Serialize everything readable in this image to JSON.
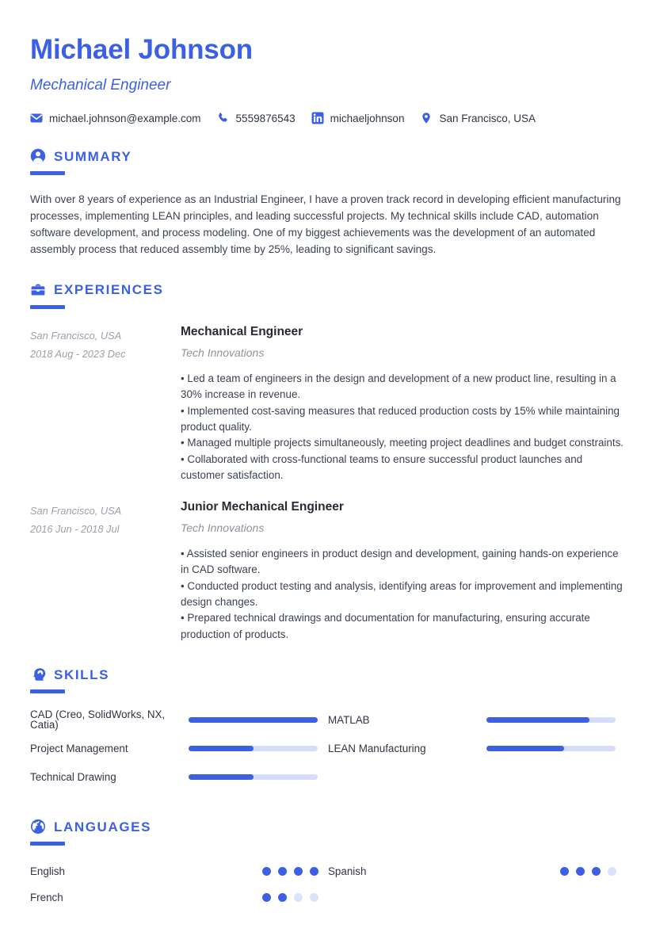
{
  "theme": {
    "accent": "#3b60e4",
    "accent_light": "#d6ddfb",
    "text": "#2f3542",
    "muted": "#9aa0a9"
  },
  "header": {
    "name": "Michael Johnson",
    "job_title": "Mechanical Engineer",
    "contacts": [
      {
        "icon": "envelope-icon",
        "text": "michael.johnson@example.com"
      },
      {
        "icon": "phone-icon",
        "text": "5559876543"
      },
      {
        "icon": "linkedin-icon",
        "text": "michaeljohnson"
      },
      {
        "icon": "location-pin-icon",
        "text": "San Francisco, USA"
      }
    ]
  },
  "summary": {
    "icon": "person-circle-icon",
    "title": "SUMMARY",
    "text": "With over 8 years of experience as an Industrial Engineer, I have a proven track record in developing efficient manufacturing processes, implementing LEAN principles, and leading successful projects. My technical skills include CAD, automation software development, and process modeling. One of my biggest achievements was the development of an automated assembly process that reduced assembly time by 25%, leading to significant savings."
  },
  "experiences": {
    "icon": "briefcase-icon",
    "title": "EXPERIENCES",
    "entries": [
      {
        "location": "San Francisco, USA",
        "dates": "2018 Aug - 2023 Dec",
        "role": "Mechanical Engineer",
        "company": "Tech Innovations",
        "bullets": [
          "• Led a team of engineers in the design and development of a new product line, resulting in a 30% increase in revenue.",
          "• Implemented cost-saving measures that reduced production costs by 15% while maintaining product quality.",
          "• Managed multiple projects simultaneously, meeting project deadlines and budget constraints.",
          "• Collaborated with cross-functional teams to ensure successful product launches and customer satisfaction."
        ]
      },
      {
        "location": "San Francisco, USA",
        "dates": "2016 Jun - 2018 Jul",
        "role": "Junior Mechanical Engineer",
        "company": "Tech Innovations",
        "bullets": [
          "• Assisted senior engineers in product design and development, gaining hands-on experience in CAD software.",
          "• Conducted product testing and analysis, identifying areas for improvement and implementing design changes.",
          "• Prepared technical drawings and documentation for manufacturing, ensuring accurate production of products."
        ]
      }
    ]
  },
  "skills": {
    "icon": "head-brain-icon",
    "title": "SKILLS",
    "left": [
      {
        "label": "CAD (Creo, SolidWorks, NX, Catia)",
        "level": 100
      },
      {
        "label": "Project Management",
        "level": 50
      },
      {
        "label": "Technical Drawing",
        "level": 50
      }
    ],
    "right": [
      {
        "label": "MATLAB",
        "level": 80
      },
      {
        "label": "LEAN Manufacturing",
        "level": 60
      }
    ]
  },
  "languages": {
    "icon": "globe-icon",
    "title": "LANGUAGES",
    "max_dots": 4,
    "left": [
      {
        "label": "English",
        "level": 4
      },
      {
        "label": "French",
        "level": 2
      }
    ],
    "right": [
      {
        "label": "Spanish",
        "level": 3
      }
    ]
  }
}
